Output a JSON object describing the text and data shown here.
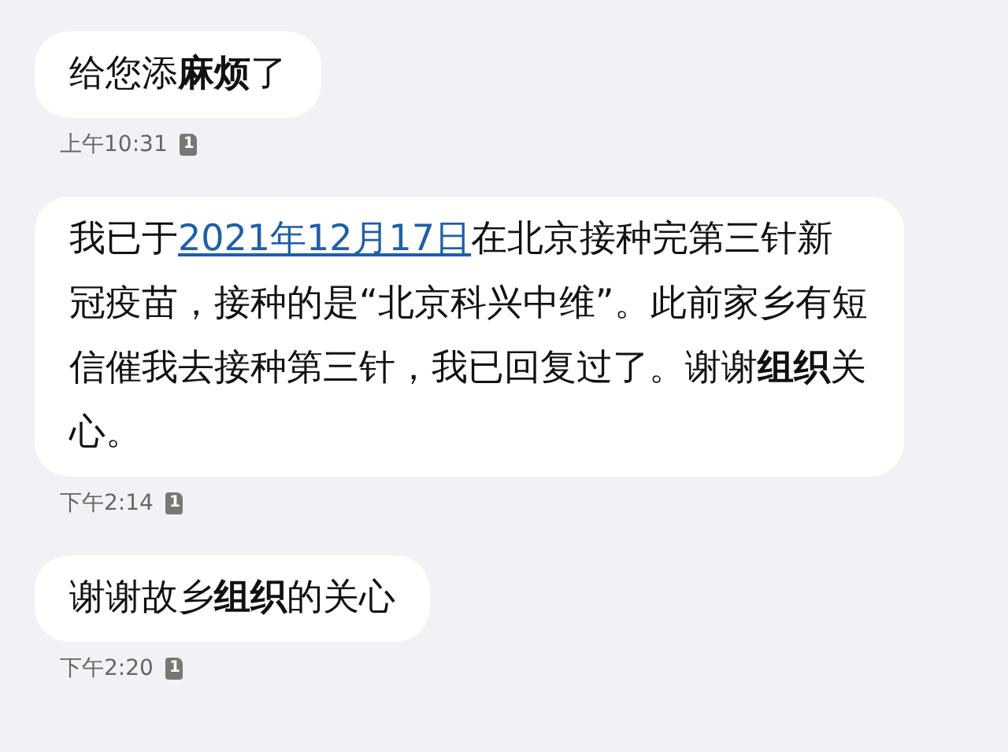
{
  "messages": [
    {
      "segments": [
        {
          "kind": "text",
          "text": "给您添**麻烦**了"
        }
      ],
      "time": "上午10:31",
      "sim": "1"
    },
    {
      "segments": [
        {
          "kind": "text",
          "text": "我已于"
        },
        {
          "kind": "link",
          "text": "2021年12月17日"
        },
        {
          "kind": "text",
          "text": "在北京接种完第三针新冠疫苗，接种的是“北京科兴中维”。此前家乡有短信催我去接种第三针，我已回复过了。谢谢**组织**关心。"
        }
      ],
      "time": "下午2:14",
      "sim": "1"
    },
    {
      "segments": [
        {
          "kind": "text",
          "text": "谢谢故乡**组织**的关心"
        }
      ],
      "time": "下午2:20",
      "sim": "1"
    }
  ]
}
